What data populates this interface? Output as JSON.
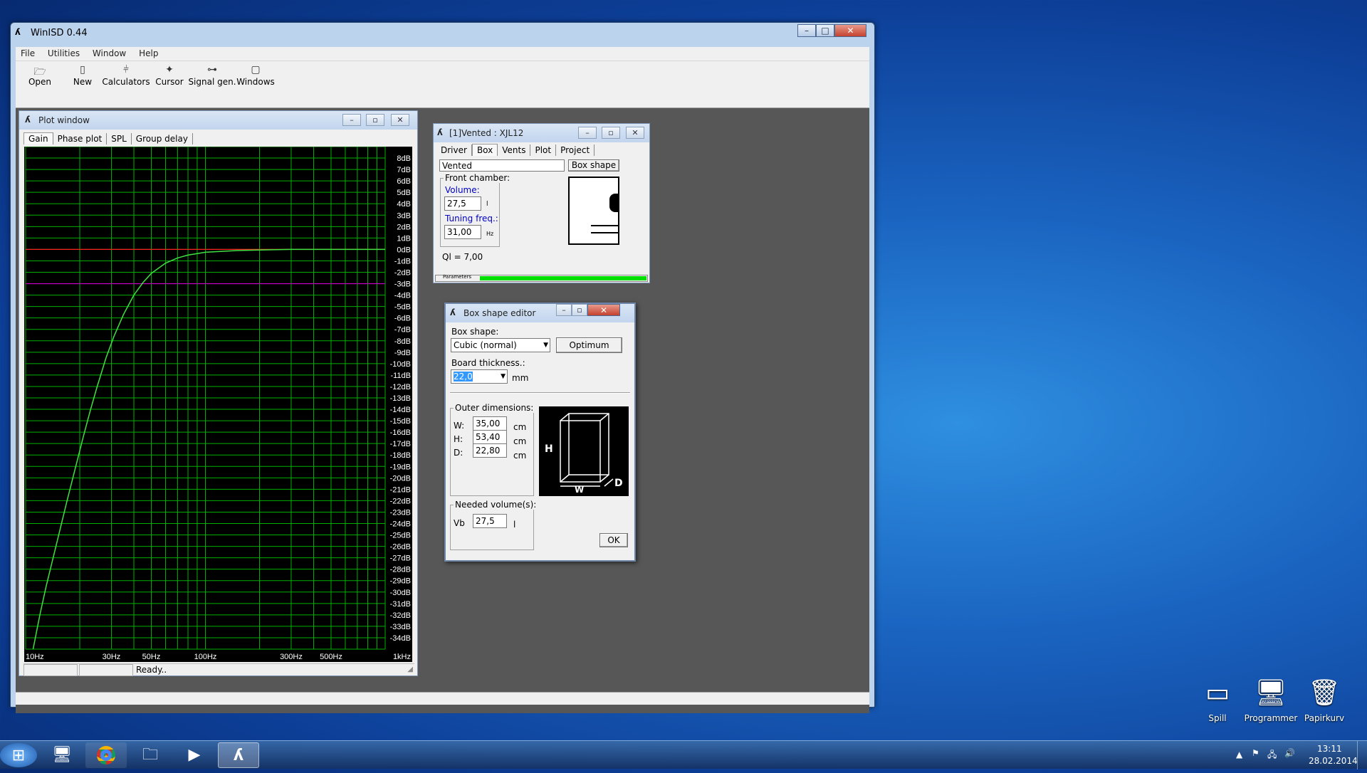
{
  "app": {
    "title": "WinISD 0.44",
    "menu": [
      "File",
      "Utilities",
      "Window",
      "Help"
    ],
    "toolbar": [
      {
        "label": "Open",
        "icon": "open-folder-icon"
      },
      {
        "label": "New",
        "icon": "new-doc-icon"
      },
      {
        "label": "Calculators",
        "icon": "calculator-icon"
      },
      {
        "label": "Cursor",
        "icon": "cursor-icon"
      },
      {
        "label": "Signal gen.",
        "icon": "signal-gen-icon"
      },
      {
        "label": "Windows",
        "icon": "windows-icon"
      }
    ]
  },
  "plot_window": {
    "title": "Plot window",
    "tabs": [
      "Gain",
      "Phase plot",
      "SPL",
      "Group delay"
    ],
    "active_tab": "Gain",
    "status": "Ready..",
    "colors": {
      "background": "#000000",
      "grid": "#00b000",
      "curve": "#40e040",
      "zero_line": "#ff2020",
      "minus3_line": "#cc00cc",
      "axis_text": "#ffffff"
    }
  },
  "chart_data": {
    "type": "line",
    "title": "",
    "xlabel": "",
    "ylabel": "",
    "x_scale": "log",
    "xlim": [
      10,
      1000
    ],
    "ylim": [
      -35,
      9
    ],
    "x_ticks": [
      "10Hz",
      "30Hz",
      "50Hz",
      "100Hz",
      "300Hz",
      "500Hz",
      "1kHz"
    ],
    "x_tick_values": [
      10,
      30,
      50,
      100,
      300,
      500,
      1000
    ],
    "y_ticks": [
      "8dB",
      "7dB",
      "6dB",
      "5dB",
      "4dB",
      "3dB",
      "2dB",
      "1dB",
      "0dB",
      "-1dB",
      "-2dB",
      "-3dB",
      "-4dB",
      "-5dB",
      "-6dB",
      "-7dB",
      "-8dB",
      "-9dB",
      "-10dB",
      "-11dB",
      "-12dB",
      "-13dB",
      "-14dB",
      "-15dB",
      "-16dB",
      "-17dB",
      "-18dB",
      "-19dB",
      "-20dB",
      "-21dB",
      "-22dB",
      "-23dB",
      "-24dB",
      "-25dB",
      "-26dB",
      "-27dB",
      "-28dB",
      "-29dB",
      "-30dB",
      "-31dB",
      "-32dB",
      "-33dB",
      "-34dB"
    ],
    "y_tick_values": [
      8,
      7,
      6,
      5,
      4,
      3,
      2,
      1,
      0,
      -1,
      -2,
      -3,
      -4,
      -5,
      -6,
      -7,
      -8,
      -9,
      -10,
      -11,
      -12,
      -13,
      -14,
      -15,
      -16,
      -17,
      -18,
      -19,
      -20,
      -21,
      -22,
      -23,
      -24,
      -25,
      -26,
      -27,
      -28,
      -29,
      -30,
      -31,
      -32,
      -33,
      -34
    ],
    "reference_lines": [
      0,
      -3
    ],
    "grid": true,
    "series": [
      {
        "x": [
          11,
          12,
          13,
          15,
          17,
          19,
          21,
          23,
          25,
          28,
          31,
          35,
          40,
          45,
          50,
          60,
          70,
          80,
          100,
          150,
          200,
          300,
          500,
          1000
        ],
        "y": [
          -35,
          -32,
          -29.5,
          -25.5,
          -22,
          -19,
          -16.3,
          -14,
          -12,
          -9.5,
          -7.6,
          -5.7,
          -4,
          -2.9,
          -2.1,
          -1.2,
          -0.75,
          -0.5,
          -0.25,
          -0.1,
          -0.05,
          0,
          0,
          0
        ]
      }
    ]
  },
  "vented_window": {
    "title": "[1]Vented : XJL12",
    "tabs": [
      "Driver",
      "Box",
      "Vents",
      "Plot",
      "Project"
    ],
    "active_tab": "Box",
    "box_type": "Vented",
    "box_shape_button": "Box shape",
    "front_chamber_label": "Front chamber:",
    "volume_label": "Volume:",
    "volume_value": "27,5",
    "volume_unit": "l",
    "tuning_label": "Tuning freq.:",
    "tuning_value": "31,00",
    "tuning_unit": "Hz",
    "ql": "Ql = 7,00",
    "parameters_label": "Parameters",
    "progress_fraction": 1.0,
    "progress_color": "#00e000"
  },
  "box_editor": {
    "title": "Box shape editor",
    "box_shape_label": "Box shape:",
    "box_shape_value": "Cubic (normal)",
    "optimum_button": "Optimum",
    "board_thickness_label": "Board thickness.:",
    "board_thickness_value": "22,0",
    "board_thickness_unit": "mm",
    "outer_dimensions_label": "Outer dimensions:",
    "dims": [
      {
        "label": "W:",
        "value": "35,00",
        "unit": "cm"
      },
      {
        "label": "H:",
        "value": "53,40",
        "unit": "cm"
      },
      {
        "label": "D:",
        "value": "22,80",
        "unit": "cm"
      }
    ],
    "diagram_labels": {
      "h": "H",
      "w": "W",
      "d": "D"
    },
    "needed_volume_label": "Needed volume(s):",
    "vb_label": "Vb",
    "vb_value": "27,5",
    "vb_unit": "l",
    "ok_button": "OK"
  },
  "desktop": {
    "icons": [
      {
        "label": "Spill",
        "icon": "games-icon"
      },
      {
        "label": "Programmer",
        "icon": "programs-icon"
      },
      {
        "label": "Papirkurv",
        "icon": "recycle-bin-icon"
      }
    ]
  },
  "taskbar": {
    "time": "13:11",
    "date": "28.02.2014"
  }
}
